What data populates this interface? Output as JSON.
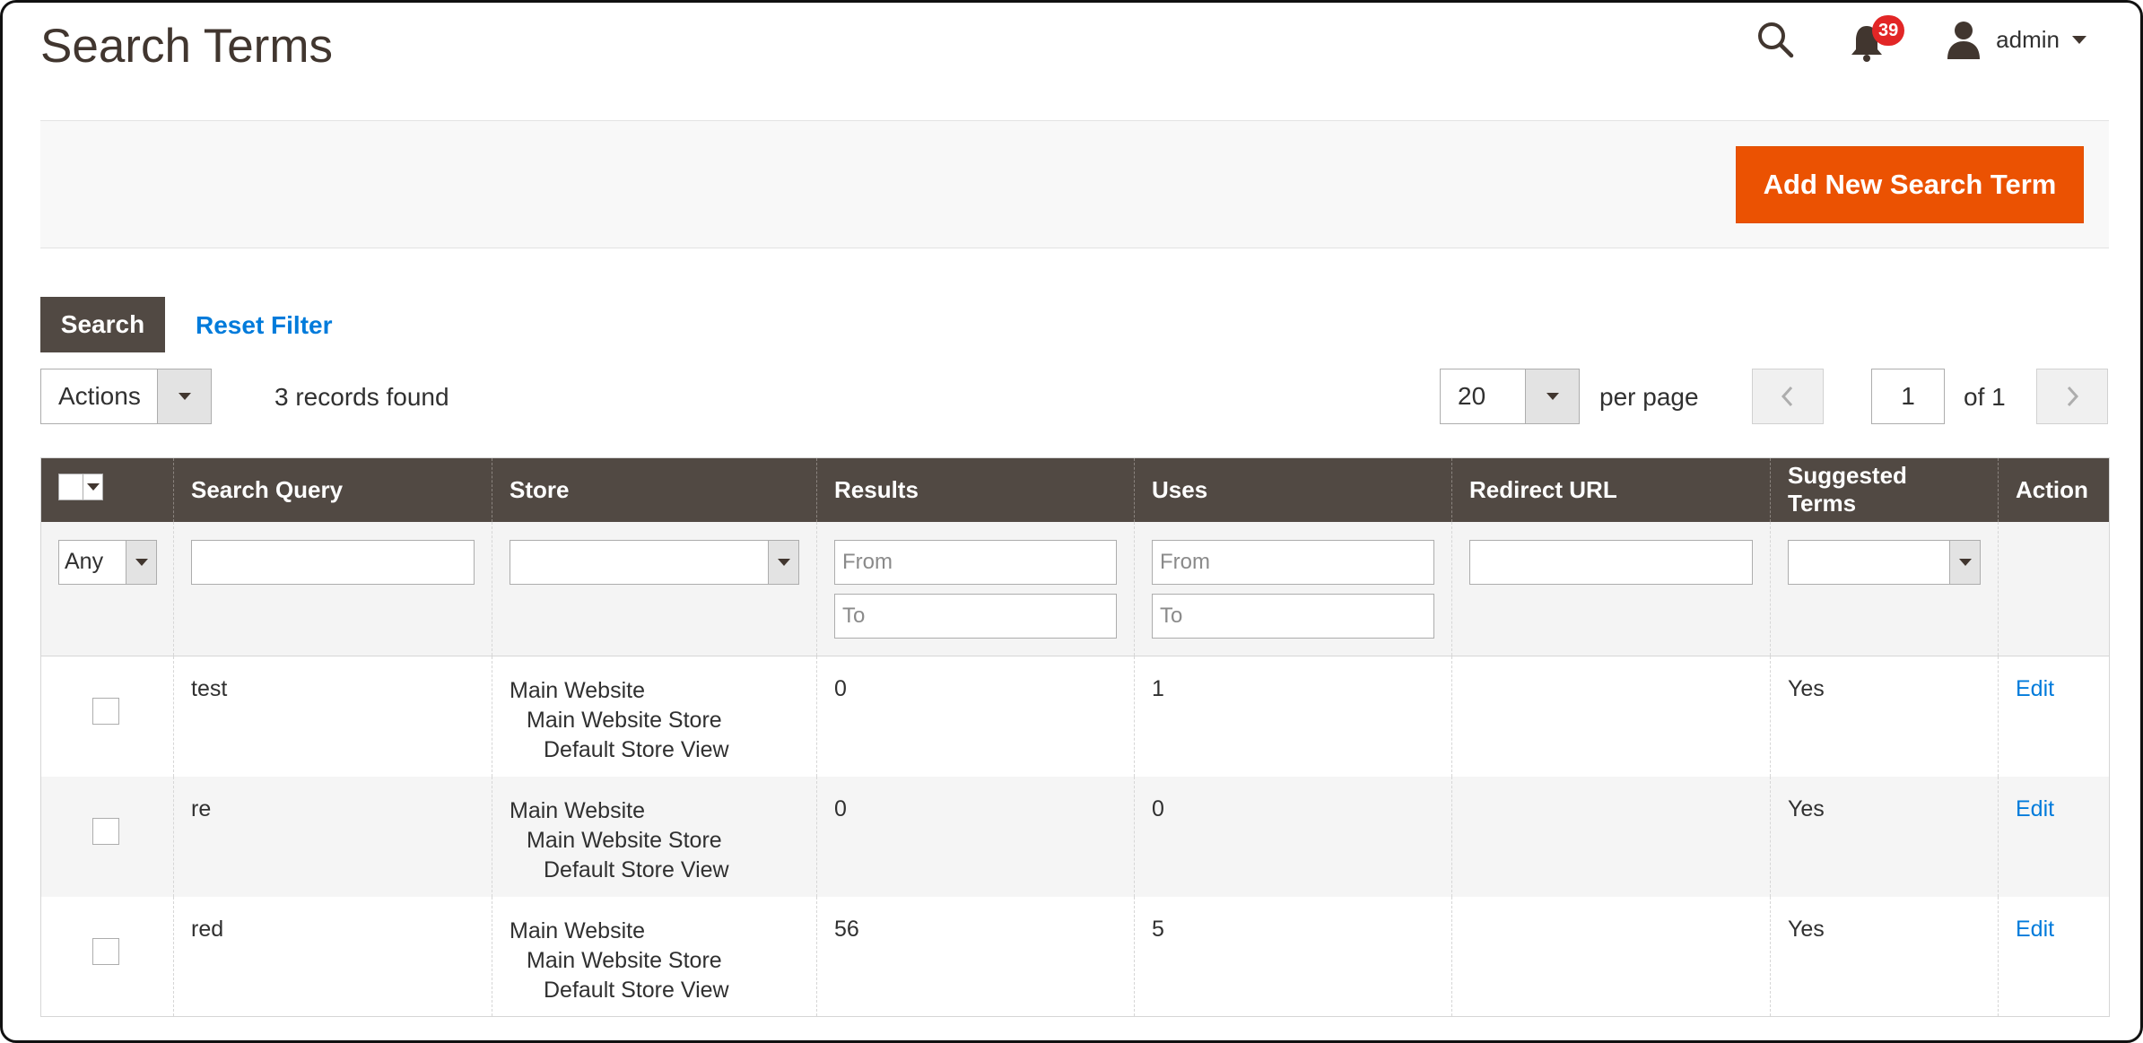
{
  "header": {
    "title": "Search Terms",
    "notification_count": "39",
    "user_name": "admin"
  },
  "action_bar": {
    "add_button_label": "Add New Search Term"
  },
  "filters": {
    "search_label": "Search",
    "reset_label": "Reset Filter"
  },
  "toolbar": {
    "actions_label": "Actions",
    "records_found": "3 records found",
    "per_page_value": "20",
    "per_page_label": "per page",
    "current_page": "1",
    "total_pages_label": "of 1"
  },
  "grid": {
    "columns": [
      "Search Query",
      "Store",
      "Results",
      "Uses",
      "Redirect URL",
      "Suggested Terms",
      "Action"
    ],
    "filter_row": {
      "mass_select_value": "Any",
      "range_from_placeholder": "From",
      "range_to_placeholder": "To"
    },
    "rows": [
      {
        "query": "test",
        "store": [
          "Main Website",
          "Main Website Store",
          "Default Store View"
        ],
        "results": "0",
        "uses": "1",
        "redirect_url": "",
        "suggested": "Yes",
        "action": "Edit"
      },
      {
        "query": "re",
        "store": [
          "Main Website",
          "Main Website Store",
          "Default Store View"
        ],
        "results": "0",
        "uses": "0",
        "redirect_url": "",
        "suggested": "Yes",
        "action": "Edit"
      },
      {
        "query": "red",
        "store": [
          "Main Website",
          "Main Website Store",
          "Default Store View"
        ],
        "results": "56",
        "uses": "5",
        "redirect_url": "",
        "suggested": "Yes",
        "action": "Edit"
      }
    ]
  },
  "colors": {
    "accent": "#eb5202",
    "header_bg": "#514943",
    "link": "#007bdb",
    "badge": "#e22626"
  },
  "icons": [
    "search-icon",
    "bell-icon",
    "user-icon",
    "chevron-left-icon",
    "chevron-right-icon"
  ]
}
